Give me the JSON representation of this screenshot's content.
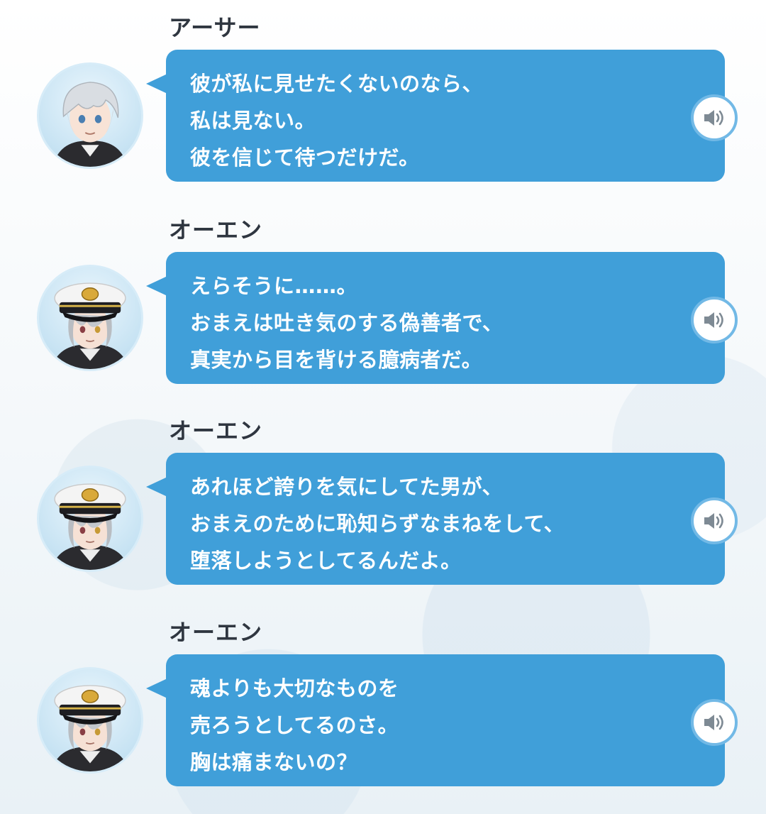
{
  "messages": [
    {
      "speaker": "アーサー",
      "avatar": "silver-haired-character-icon",
      "lines": "彼が私に見せたくないのなら、\n私は見ない。\n彼を信じて待つだけだ。"
    },
    {
      "speaker": "オーエン",
      "avatar": "captain-hat-character-icon",
      "lines": "えらそうに……。\nおまえは吐き気のする偽善者で、\n真実から目を背ける臆病者だ。"
    },
    {
      "speaker": "オーエン",
      "avatar": "captain-hat-character-icon",
      "lines": "あれほど誇りを気にしてた男が、\nおまえのために恥知らずなまねをして、\n堕落しようとしてるんだよ。"
    },
    {
      "speaker": "オーエン",
      "avatar": "captain-hat-character-icon",
      "lines": "魂よりも大切なものを\n売ろうとしてるのさ。\n胸は痛まないの？"
    }
  ],
  "voice_button_icon": "speaker-volume-icon",
  "colors": {
    "bubble": "#409fd9",
    "name_text": "#2f3640",
    "bubble_text": "#ffffff"
  }
}
